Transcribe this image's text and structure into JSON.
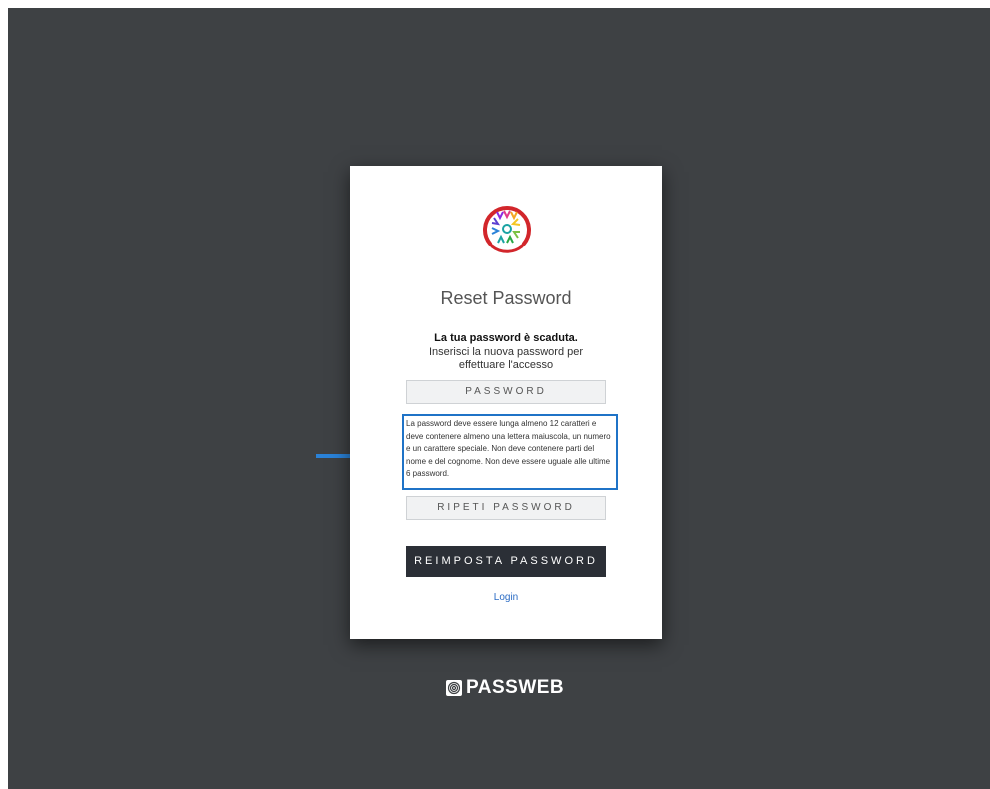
{
  "form": {
    "title": "Reset Password",
    "message_strong": "La tua password è scaduta.",
    "message_sub": "Inserisci la nuova password per effettuare l'accesso",
    "password_placeholder": "PASSWORD",
    "hint": "La password deve essere lunga almeno 12 caratteri e deve contenere almeno una lettera maiuscola, un numero e un carattere speciale. Non deve contenere parti del nome e del cognome. Non deve essere uguale alle ultime 6 password.",
    "repeat_password_placeholder": "RIPETI PASSWORD",
    "submit_label": "REIMPOSTA PASSWORD",
    "login_link": "Login"
  },
  "footer": {
    "brand_name": "PASSWEB"
  },
  "icons": {
    "logo": "sun-rays-logo-icon",
    "arrow": "arrow-right-icon",
    "brand": "passweb-fingerprint-icon"
  },
  "colors": {
    "background": "#3e4144",
    "card": "#ffffff",
    "button": "#2b2f36",
    "highlight_border": "#1f73c7",
    "link": "#2a6bc4",
    "logo_ring": "#d2262b"
  }
}
